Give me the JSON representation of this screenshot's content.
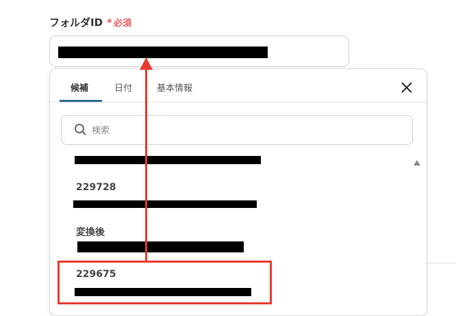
{
  "field": {
    "label": "フォルダID",
    "required_mark": "*",
    "required_text": "必須"
  },
  "tabs": [
    {
      "label": "候補",
      "active": true
    },
    {
      "label": "日付",
      "active": false
    },
    {
      "label": "基本情報",
      "active": false
    }
  ],
  "search": {
    "placeholder": "検索",
    "value": ""
  },
  "list": [
    {
      "title": ""
    },
    {
      "title": "229728"
    },
    {
      "title": "変換後"
    },
    {
      "title": "229675"
    }
  ],
  "colors": {
    "accent_tab": "#2a6c95",
    "required": "#e85a5a",
    "annotation": "#e8392a"
  },
  "icons": {
    "close": "close-icon",
    "search": "search-icon",
    "scroll_up": "triangle-up-icon"
  }
}
